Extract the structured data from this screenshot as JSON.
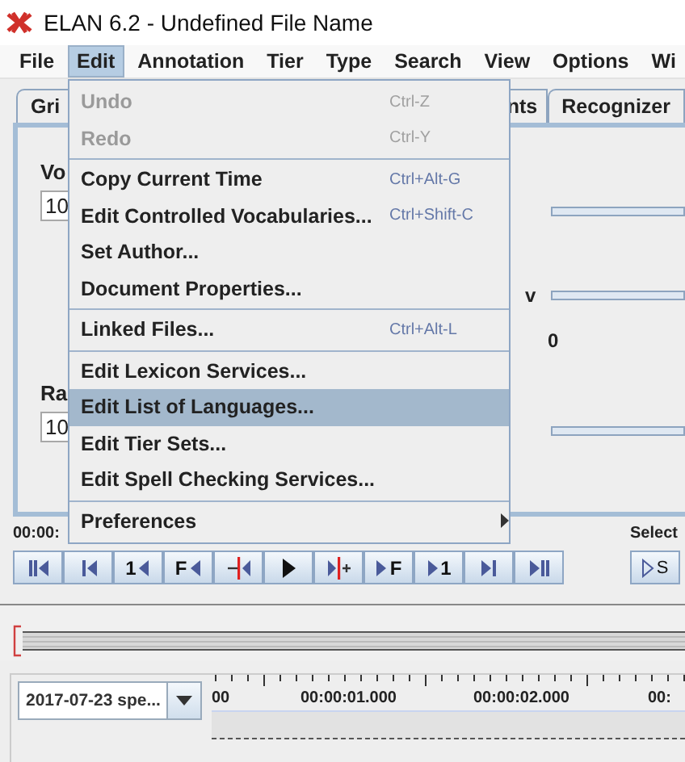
{
  "window": {
    "title": "ELAN 6.2 - Undefined File Name"
  },
  "menubar": [
    {
      "label": "File",
      "selected": false
    },
    {
      "label": "Edit",
      "selected": true
    },
    {
      "label": "Annotation",
      "selected": false
    },
    {
      "label": "Tier",
      "selected": false
    },
    {
      "label": "Type",
      "selected": false
    },
    {
      "label": "Search",
      "selected": false
    },
    {
      "label": "View",
      "selected": false
    },
    {
      "label": "Options",
      "selected": false
    },
    {
      "label": "Wi",
      "selected": false
    }
  ],
  "tabs": [
    {
      "label": "Gri",
      "selected": false
    },
    {
      "label": "nts",
      "selected": false
    },
    {
      "label": "Recognizer",
      "selected": false
    }
  ],
  "panel": {
    "volume_label": "Vo",
    "volume_value": "10",
    "rate_label": "Ra",
    "rate_value": "10",
    "slider_label": "v",
    "slider_value": "0"
  },
  "time_label": "00:00:",
  "selection_label": "Select",
  "transport": [
    {
      "kind": "begin"
    },
    {
      "kind": "step-back"
    },
    {
      "kind": "back",
      "label": "1"
    },
    {
      "kind": "back",
      "label": "F"
    },
    {
      "kind": "back-mark"
    },
    {
      "kind": "play"
    },
    {
      "kind": "forward-mark"
    },
    {
      "kind": "forward",
      "label": "F"
    },
    {
      "kind": "forward",
      "label": "1"
    },
    {
      "kind": "step-forward"
    },
    {
      "kind": "end"
    }
  ],
  "selection_buttons": [
    {
      "kind": "forward",
      "label": "S"
    }
  ],
  "tier_dropdown": {
    "value": "2017-07-23 spe..."
  },
  "ruler": [
    "00",
    "00:00:01.000",
    "00:00:02.000",
    "00:"
  ],
  "edit_menu": {
    "groups": [
      [
        {
          "label": "Undo",
          "shortcut": "Ctrl-Z",
          "disabled": true,
          "selected": false
        },
        {
          "label": "Redo",
          "shortcut": "Ctrl-Y",
          "disabled": true,
          "selected": false
        }
      ],
      [
        {
          "label": "Copy Current Time",
          "shortcut": "Ctrl+Alt-G",
          "disabled": false,
          "selected": false
        },
        {
          "label": "Edit Controlled Vocabularies...",
          "shortcut": "Ctrl+Shift-C",
          "disabled": false,
          "selected": false
        },
        {
          "label": "Set Author...",
          "disabled": false,
          "selected": false
        },
        {
          "label": "Document Properties...",
          "disabled": false,
          "selected": false
        }
      ],
      [
        {
          "label": "Linked Files...",
          "shortcut": "Ctrl+Alt-L",
          "disabled": false,
          "selected": false
        }
      ],
      [
        {
          "label": "Edit Lexicon Services...",
          "disabled": false,
          "selected": false
        },
        {
          "label": "Edit List of Languages...",
          "disabled": false,
          "selected": true
        },
        {
          "label": "Edit Tier Sets...",
          "disabled": false,
          "selected": false
        },
        {
          "label": "Edit Spell Checking Services...",
          "disabled": false,
          "selected": false
        }
      ],
      [
        {
          "label": "Preferences",
          "submenu": true,
          "disabled": false,
          "selected": false
        }
      ]
    ]
  }
}
